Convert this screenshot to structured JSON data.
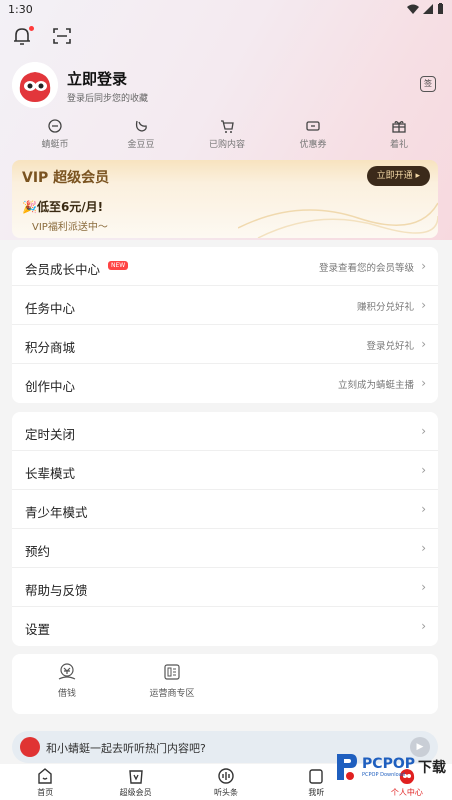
{
  "status": {
    "time": "1:30"
  },
  "profile": {
    "title": "立即登录",
    "subtitle": "登录后同步您的收藏",
    "sign_label": "签"
  },
  "quick_items": [
    {
      "label": "蜻蜓币",
      "icon": "coin-icon"
    },
    {
      "label": "金豆豆",
      "icon": "bean-icon"
    },
    {
      "label": "已购内容",
      "icon": "cart-icon"
    },
    {
      "label": "优惠券",
      "icon": "coupon-icon"
    },
    {
      "label": "着礼",
      "icon": "gift-icon"
    }
  ],
  "vip": {
    "title": "VIP 超级会员",
    "button": "立即开通",
    "promo": "低至6元/月!",
    "sub": "VIP福利派送中～"
  },
  "menu1": [
    {
      "label": "会员成长中心",
      "badge": "NEW",
      "right": "登录查看您的会员等级"
    },
    {
      "label": "任务中心",
      "right": "赚积分兑好礼"
    },
    {
      "label": "积分商城",
      "right": "登录兑好礼"
    },
    {
      "label": "创作中心",
      "right": "立刻成为蜻蜓主播"
    }
  ],
  "menu2": [
    {
      "label": "定时关闭"
    },
    {
      "label": "长辈模式"
    },
    {
      "label": "青少年模式"
    },
    {
      "label": "预约"
    },
    {
      "label": "帮助与反馈"
    },
    {
      "label": "设置"
    }
  ],
  "tools": [
    {
      "label": "借钱",
      "icon": "loan-icon"
    },
    {
      "label": "运营商专区",
      "icon": "sim-card-icon"
    }
  ],
  "prompt": {
    "text": "和小蜻蜓一起去听听热门内容吧?"
  },
  "nav": [
    {
      "label": "首页",
      "icon": "home-icon"
    },
    {
      "label": "超级会员",
      "icon": "vip-icon"
    },
    {
      "label": "听头条",
      "icon": "headline-icon"
    },
    {
      "label": "我听",
      "icon": "listen-icon"
    },
    {
      "label": "个人中心",
      "icon": "profile-icon",
      "active": true
    }
  ],
  "watermark": {
    "main": "PCPOP",
    "small": "PCPOP Download",
    "tail": "下载"
  },
  "colors": {
    "accent": "#e02020",
    "vip_button_bg": "#3b2a1a",
    "vip_gold": "#f7e3bf"
  }
}
